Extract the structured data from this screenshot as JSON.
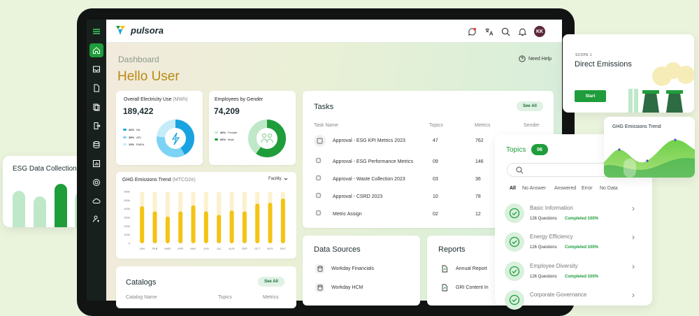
{
  "app": {
    "name": "pulsora",
    "avatar_initials": "KK"
  },
  "page": {
    "title": "Dashboard",
    "greeting": "Hello User",
    "help": "Need Help"
  },
  "electricity": {
    "title": "Overall Electricity Use",
    "unit": "(MWh)",
    "value": "189,422",
    "legend": [
      {
        "pct": "42%",
        "label": "NA",
        "color": "#1aa3e0"
      },
      {
        "pct": "35%",
        "label": "APL",
        "color": "#7cd3f5"
      },
      {
        "pct": "13%",
        "label": "EMEA",
        "color": "#c6ecf9"
      }
    ]
  },
  "gender": {
    "title": "Employees by Gender",
    "value": "74,209",
    "legend": [
      {
        "pct": "40%",
        "label": "Female",
        "color": "#bfe8c9"
      },
      {
        "pct": "60%",
        "label": "Male",
        "color": "#1f9d3b"
      }
    ]
  },
  "ghg": {
    "title": "GHG Emissions Trend",
    "unit": "(MTCO2e)",
    "filter": "Facility"
  },
  "chart_data": {
    "type": "bar",
    "categories": [
      "JAN",
      "FEB",
      "MAR",
      "APR",
      "MAY",
      "JUN",
      "JUL",
      "AUG",
      "SEP",
      "OCT",
      "NOV",
      "DEC"
    ],
    "values": [
      430,
      370,
      310,
      370,
      440,
      370,
      330,
      380,
      370,
      460,
      470,
      520
    ],
    "yticks": [
      "0",
      "100k",
      "200k",
      "300k",
      "400k",
      "500k",
      "600k"
    ],
    "ylim": [
      0,
      600
    ],
    "colors": {
      "bar": "#f4c314",
      "track": "#fbf1cd"
    }
  },
  "catalogs": {
    "title": "Catalogs",
    "button": "See All",
    "col_name": "Catalog Name",
    "col_topics": "Topics",
    "col_metrics": "Metrics"
  },
  "tasks": {
    "title": "Tasks",
    "button": "See All",
    "headers": {
      "name": "Task Name",
      "topics": "Topics",
      "metrics": "Metrics",
      "sender": "Sender"
    },
    "rows": [
      {
        "name": "Approval - ESG KPI Metrics 2023",
        "topics": "47",
        "metrics": "762"
      },
      {
        "name": "Approval - ESG Performance Metrics",
        "topics": "09",
        "metrics": "146"
      },
      {
        "name": "Approval - Waste Collection 2023",
        "topics": "03",
        "metrics": "36"
      },
      {
        "name": "Approval - CSRD 2023",
        "topics": "10",
        "metrics": "78"
      },
      {
        "name": "Metric Assign",
        "topics": "02",
        "metrics": "12"
      }
    ]
  },
  "data_sources": {
    "title": "Data Sources",
    "items": [
      "Workday Financials",
      "Workday HCM"
    ]
  },
  "reports": {
    "title": "Reports",
    "items": [
      "Annual Report",
      "GRI Content In"
    ]
  },
  "topics": {
    "title": "Topics",
    "count": "06",
    "filters": [
      "All",
      "No Answer",
      "Answered",
      "Error",
      "No Data"
    ],
    "items": [
      {
        "name": "Basic Information",
        "questions": "126  Questions",
        "status": "Completed 100%"
      },
      {
        "name": "Energy Efficiency",
        "questions": "126  Questions",
        "status": "Completed 100%"
      },
      {
        "name": "Employee Diversity",
        "questions": "126  Questions",
        "status": "Completed 100%"
      },
      {
        "name": "Corporate Governance",
        "questions": "",
        "status": ""
      }
    ]
  },
  "scope": {
    "label": "SCOPE 1",
    "title": "Direct Emissions",
    "button": "Start"
  },
  "ghg_float": {
    "title": "GHG Emissions Trend"
  },
  "esg_float": {
    "title": "ESG Data Collection"
  }
}
